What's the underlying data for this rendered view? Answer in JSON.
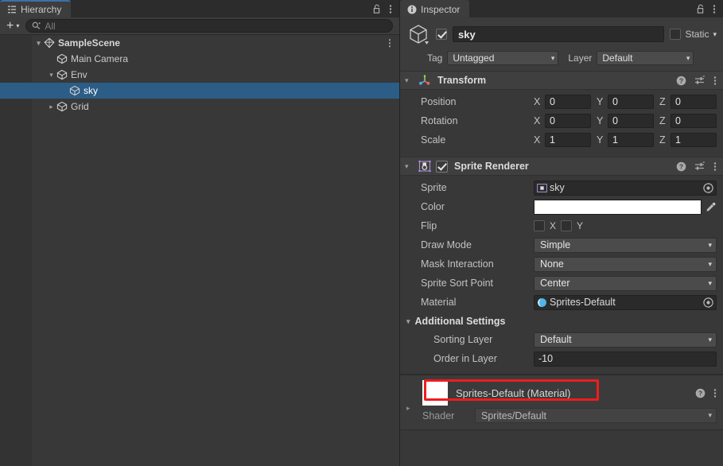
{
  "hierarchy": {
    "tab_label": "Hierarchy",
    "tab_icon": "hierarchy-icon",
    "lock_icon": "lock-open-icon",
    "menu_icon": "kebab-menu-icon",
    "toolbar": {
      "create_label": "+",
      "create_caret": "▾",
      "search_icon": "search-icon",
      "search_placeholder": "All",
      "search_value": ""
    },
    "rows": [
      {
        "label": "SampleScene",
        "icon": "scene-icon",
        "depth": 0,
        "twisty": "▾",
        "selected": false,
        "bold": true,
        "kebab": "⋮"
      },
      {
        "label": "Main Camera",
        "icon": "gameobject-cube-icon",
        "depth": 1,
        "twisty": "",
        "selected": false,
        "bold": false,
        "kebab": ""
      },
      {
        "label": "Env",
        "icon": "gameobject-cube-icon",
        "depth": 1,
        "twisty": "▾",
        "selected": false,
        "bold": false,
        "kebab": ""
      },
      {
        "label": "sky",
        "icon": "gameobject-cube-icon",
        "depth": 2,
        "twisty": "",
        "selected": true,
        "bold": false,
        "kebab": ""
      },
      {
        "label": "Grid",
        "icon": "gameobject-cube-icon",
        "depth": 1,
        "twisty": "▸",
        "selected": false,
        "bold": false,
        "kebab": ""
      }
    ]
  },
  "inspector": {
    "tab_label": "Inspector",
    "tab_icon": "info-icon",
    "lock_icon": "lock-open-icon",
    "menu_icon": "kebab-menu-icon",
    "gameobject": {
      "icon": "gameobject-cube-icon",
      "enabled": true,
      "name": "sky",
      "static_checked": false,
      "static_label": "Static",
      "static_caret": "▾",
      "tag_label": "Tag",
      "tag_value": "Untagged",
      "layer_label": "Layer",
      "layer_value": "Default",
      "caret": "▾"
    },
    "transform": {
      "title": "Transform",
      "icon": "transform-gizmo-icon",
      "foldout": "▾",
      "help_icon": "help-icon",
      "preset_icon": "preset-slider-icon",
      "menu_icon": "kebab-menu-icon",
      "rows": [
        {
          "label": "Position",
          "x": "0",
          "y": "0",
          "z": "0"
        },
        {
          "label": "Rotation",
          "x": "0",
          "y": "0",
          "z": "0"
        },
        {
          "label": "Scale",
          "x": "1",
          "y": "1",
          "z": "1"
        }
      ],
      "axis_labels": [
        "X",
        "Y",
        "Z"
      ]
    },
    "sprite_renderer": {
      "title": "Sprite Renderer",
      "icon": "sprite-renderer-icon",
      "foldout": "▾",
      "enabled": true,
      "help_icon": "help-icon",
      "preset_icon": "preset-slider-icon",
      "menu_icon": "kebab-menu-icon",
      "sprite_label": "Sprite",
      "sprite_value": "sky",
      "sprite_icon": "sprite-asset-icon",
      "sprite_picker_icon": "object-picker-icon",
      "color_label": "Color",
      "color_value": "#FFFFFF",
      "eyedropper_icon": "eyedropper-icon",
      "flip_label": "Flip",
      "flip_x_label": "X",
      "flip_y_label": "Y",
      "flip_x": false,
      "flip_y": false,
      "draw_mode_label": "Draw Mode",
      "draw_mode_value": "Simple",
      "mask_interaction_label": "Mask Interaction",
      "mask_interaction_value": "None",
      "sort_point_label": "Sprite Sort Point",
      "sort_point_value": "Center",
      "material_label": "Material",
      "material_value": "Sprites-Default",
      "material_icon": "material-sphere-icon",
      "material_picker_icon": "object-picker-icon",
      "additional_settings_label": "Additional Settings",
      "additional_settings_foldout": "▾",
      "sorting_layer_label": "Sorting Layer",
      "sorting_layer_value": "Default",
      "order_in_layer_label": "Order in Layer",
      "order_in_layer_value": "-10",
      "caret": "▾"
    },
    "material_block": {
      "title": "Sprites-Default (Material)",
      "swatch_color": "#FFFFFF",
      "foldout": "▸",
      "help_icon": "help-icon",
      "menu_icon": "kebab-menu-icon",
      "shader_label": "Shader",
      "shader_value": "Sprites/Default",
      "caret": "▾"
    }
  },
  "annotation": {
    "highlight_color": "#F01C1C",
    "highlight_target": "order-in-layer-row"
  }
}
